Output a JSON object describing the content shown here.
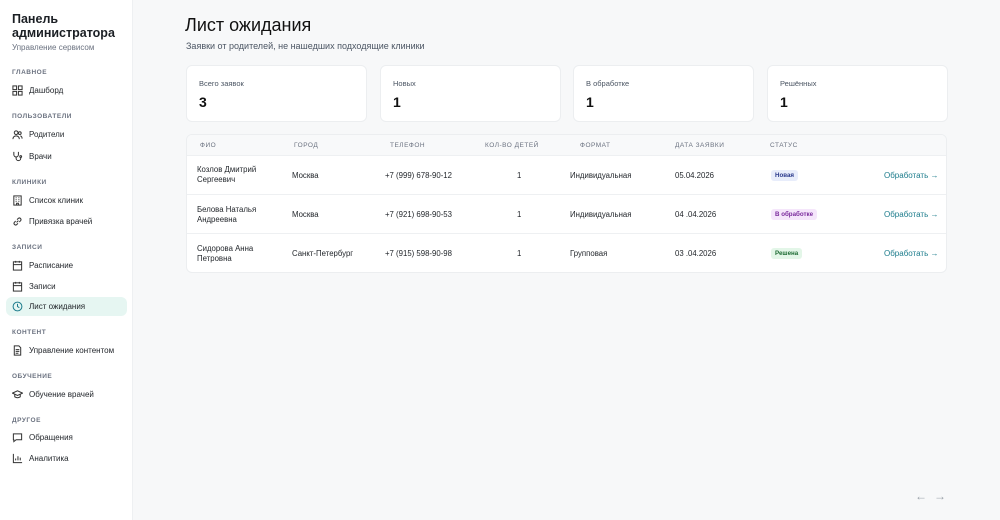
{
  "sidebar": {
    "title": "Панель администратора",
    "subtitle": "Управление сервисом",
    "sections": {
      "main": "ГЛАВНОЕ",
      "users": "ПОЛЬЗОВАТЕЛИ",
      "clinics": "КЛИНИКИ",
      "records": "ЗАПИСИ",
      "content": "КОНТЕНТ",
      "learning": "ОБУЧЕНИЕ",
      "other": "ДРУГОЕ"
    },
    "items": {
      "dashboard": "Дашборд",
      "parents": "Родители",
      "doctors": "Врачи",
      "clinic_list": "Список клиник",
      "doctor_binding": "Привязка врачей",
      "schedule": "Расписание",
      "records": "Записи",
      "waitlist": "Лист ожидания",
      "content_mgmt": "Управление контентом",
      "doctor_training": "Обучение врачей",
      "messages": "Обращения",
      "analytics": "Аналитика"
    }
  },
  "page": {
    "title": "Лист ожидания",
    "subtitle": "Заявки от родителей, не нашедших подходящие клиники"
  },
  "stats": [
    {
      "label": "Всего заявок",
      "value": "3"
    },
    {
      "label": "Новых",
      "value": "1"
    },
    {
      "label": "В обработке",
      "value": "1"
    },
    {
      "label": "Решённых",
      "value": "1"
    }
  ],
  "table": {
    "headers": [
      "ФИО",
      "ГОРОД",
      "ТЕЛЕФОН",
      "КОЛ-ВО ДЕТЕЙ",
      "ФОРМАТ",
      "ДАТА ЗАЯВКИ",
      "СТАТУС"
    ],
    "rows": [
      {
        "name": "Козлов Дмитрий Сергеевич",
        "city": "Москва",
        "phone": "+7 (999) 678-90-12",
        "kids": "1",
        "format": "Индивидуальная",
        "date": "05.04.2026",
        "status": "Новая",
        "action": "Обработать →"
      },
      {
        "name": "Белова Наталья Андреевна",
        "city": "Москва",
        "phone": "+7 (921) 698-90-53",
        "kids": "1",
        "format": "Индивидуальная",
        "date": "04 .04.2026",
        "status": "В обработке",
        "action": "Обработать →"
      },
      {
        "name": "Сидорова Анна Петровна",
        "city": "Санкт-Петербург",
        "phone": "+7 (915) 598-90-98",
        "kids": "1",
        "format": "Групповая",
        "date": "03 .04.2026",
        "status": "Решена",
        "action": "Обработать →"
      }
    ]
  },
  "status_colors": {
    "new": {
      "bg": "#e8edfb",
      "fg": "#2b3a8c"
    },
    "in_progress": {
      "bg": "#f5e6fb",
      "fg": "#7a2a9c"
    },
    "resolved": {
      "bg": "#e3f6e8",
      "fg": "#1d6b33"
    }
  },
  "accent": "#1c7c8c",
  "pager": {
    "prev": "←",
    "next": "→"
  }
}
